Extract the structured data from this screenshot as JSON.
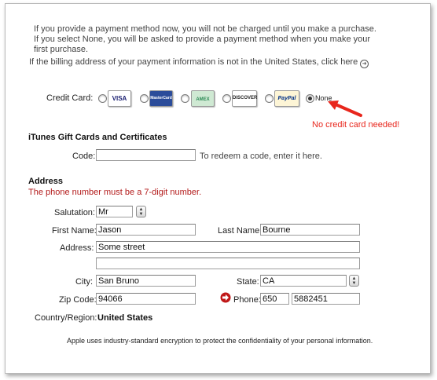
{
  "intro": {
    "text": "If you provide a payment method now, you will not be charged until you make a purchase. If you select None, you will be asked to provide a payment method when you make your first purchase.",
    "billing_link": "If the billing address of your payment information is not in the United States, click here"
  },
  "payment": {
    "label": "Credit Card:",
    "cards": [
      {
        "name": "VISA",
        "color": "#1a1f71"
      },
      {
        "name": "MasterCard",
        "color": "#cc0000"
      },
      {
        "name": "AMEX",
        "color": "#2e8b57"
      },
      {
        "name": "DISCOVER",
        "color": "#f48120"
      },
      {
        "name": "PayPal",
        "color": "#003087"
      }
    ],
    "none_label": "None",
    "selected": "None",
    "annotation": "No credit card needed!"
  },
  "giftcards": {
    "heading": "iTunes Gift Cards and Certificates",
    "code_label": "Code:",
    "code_value": "",
    "hint": "To redeem a code, enter it here."
  },
  "address": {
    "heading": "Address",
    "error": "The phone number must be a 7-digit number.",
    "salutation_label": "Salutation:",
    "salutation": "Mr",
    "first_name_label": "First Name:",
    "first_name": "Jason",
    "last_name_label": "Last Name:",
    "last_name": "Bourne",
    "address_label": "Address:",
    "address_line1": "Some street",
    "address_line2": "",
    "city_label": "City:",
    "city": "San Bruno",
    "state_label": "State:",
    "state": "CA",
    "zip_label": "Zip Code:",
    "zip": "94066",
    "phone_label": "Phone:",
    "phone_area": "650",
    "phone_number": "5882451",
    "country_label": "Country/Region:",
    "country": "United States"
  },
  "footer": {
    "security": "Apple uses industry-standard encryption to protect the confidentiality of your personal information."
  },
  "colors": {
    "error": "#b31a1a",
    "annotation": "#e8261c"
  }
}
